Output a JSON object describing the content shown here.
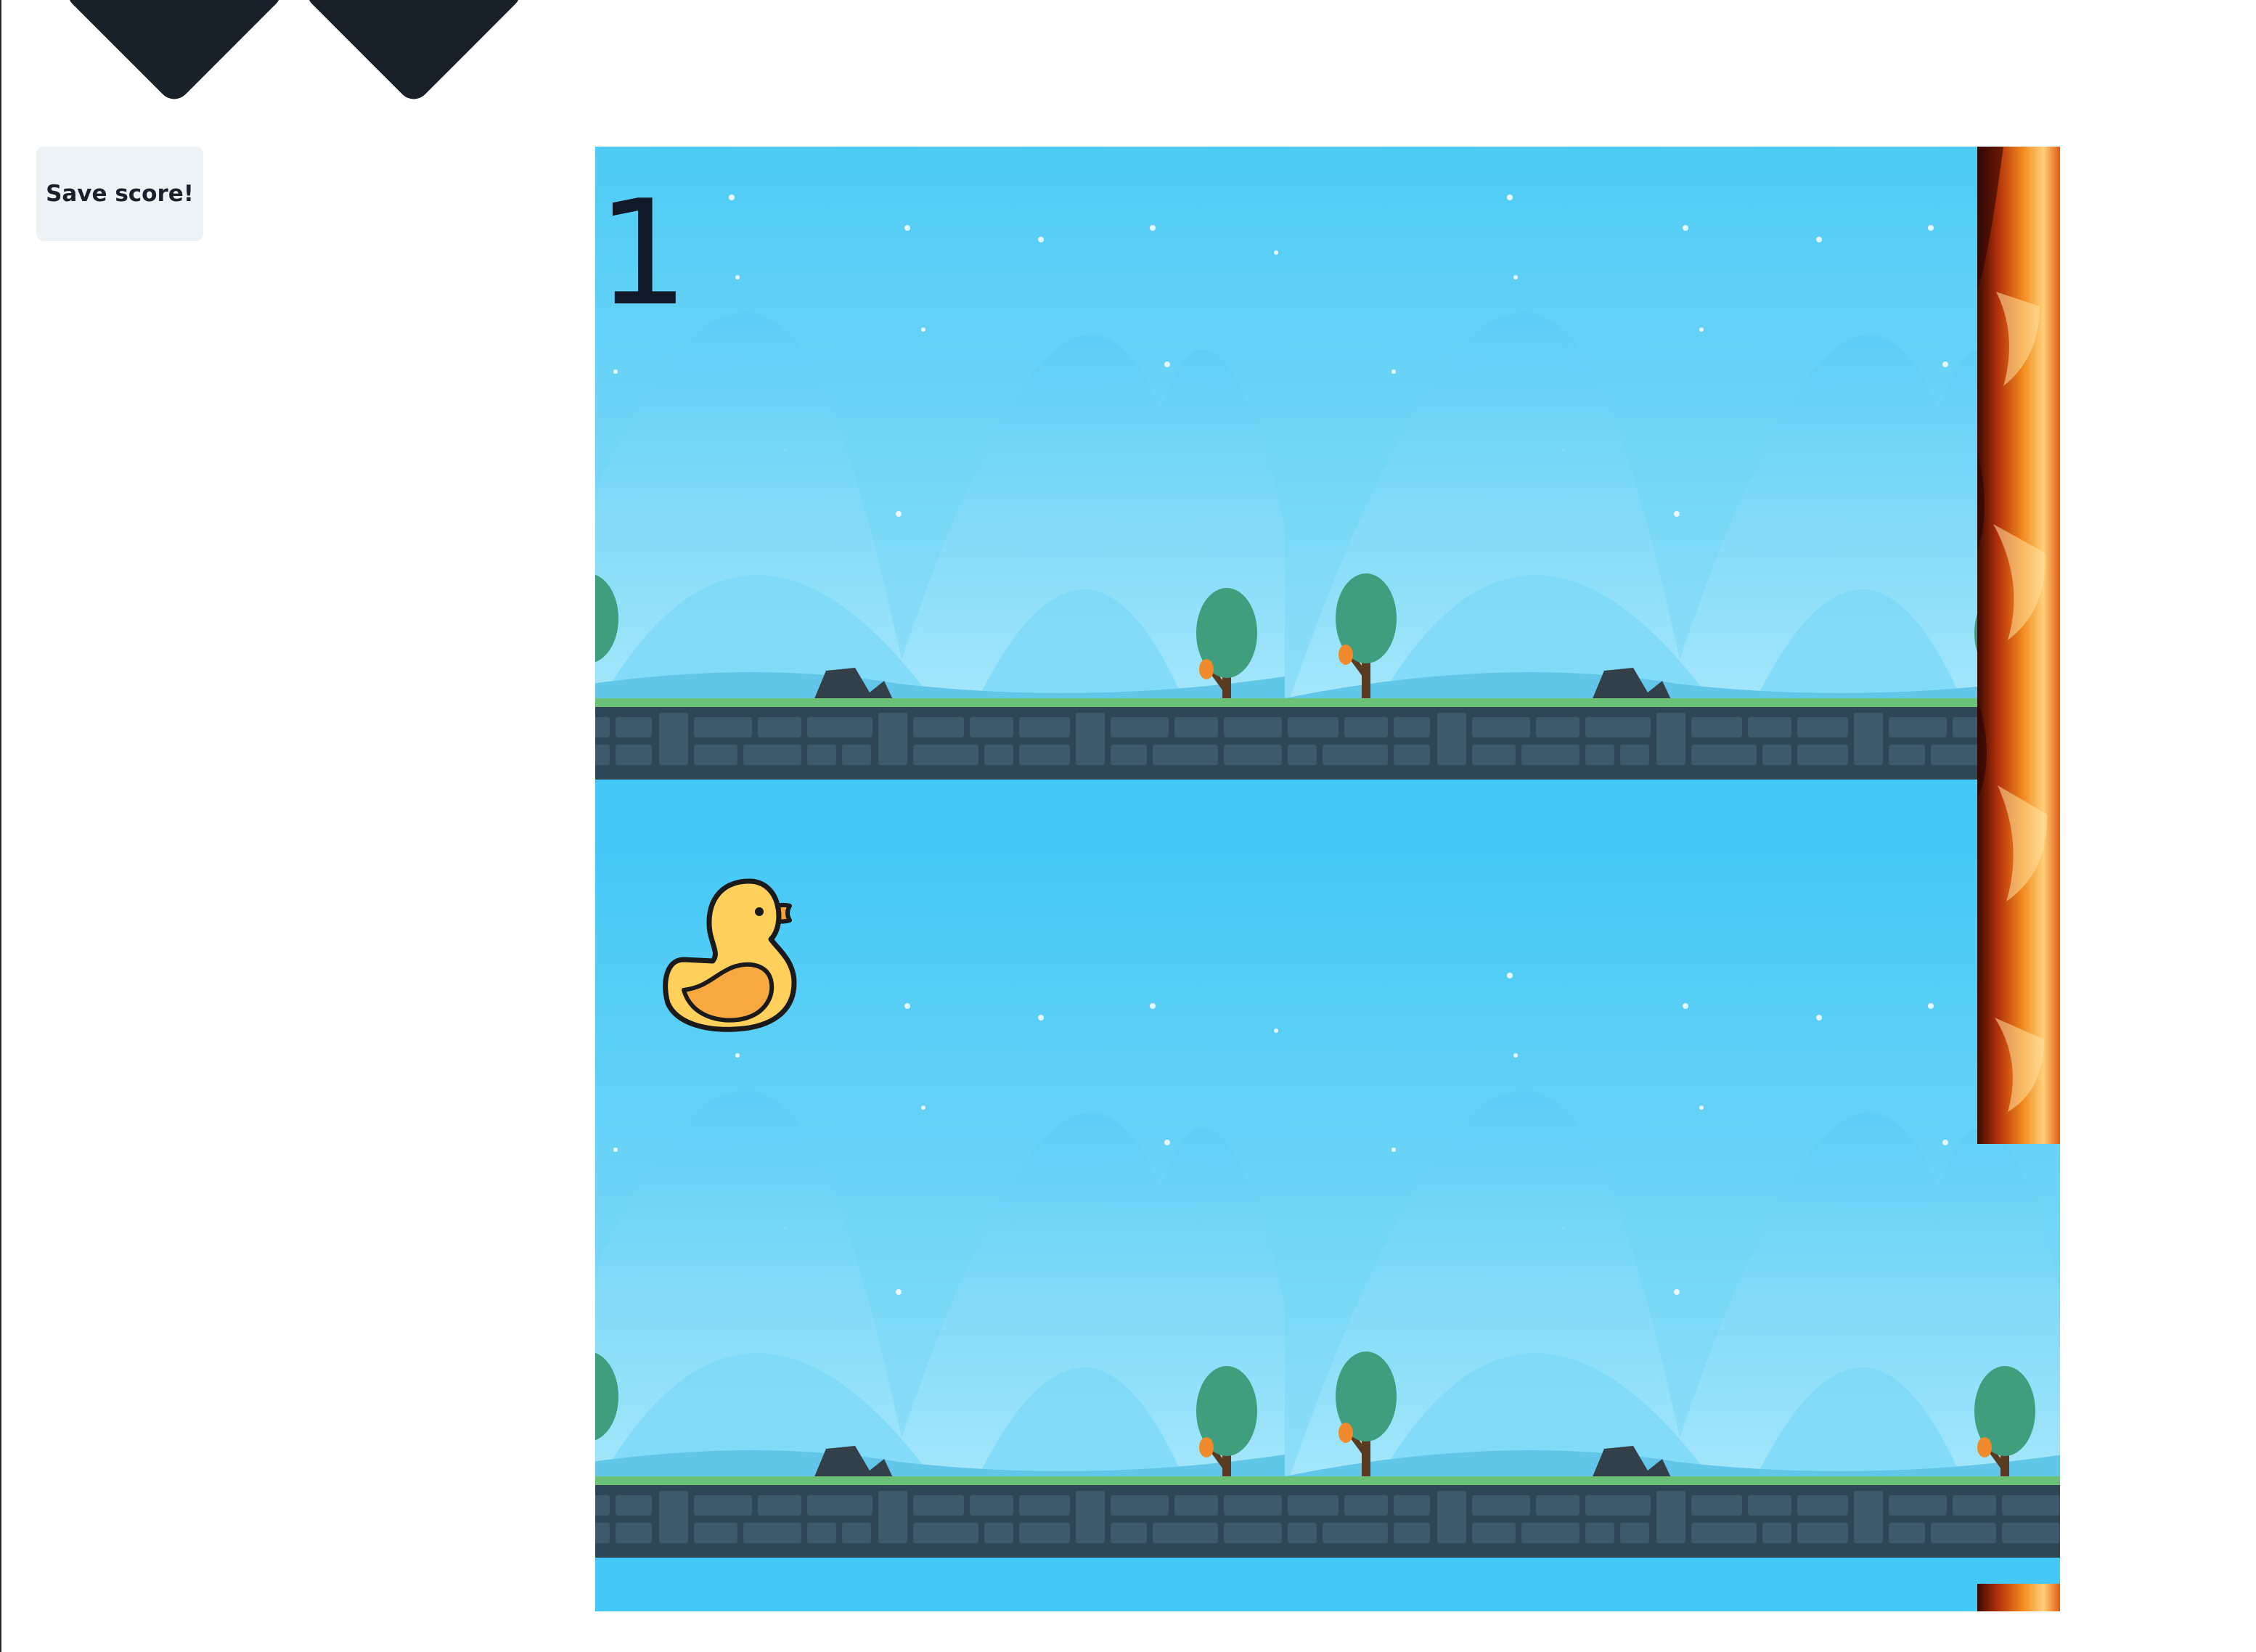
{
  "save_button": {
    "label": "Save score!"
  },
  "game": {
    "score": "1",
    "player_icon": "duck-icon",
    "obstacle_icon": "fire-icon",
    "logo_icon": "chevron-logo-icon",
    "colors": {
      "sky": "#44c8f5",
      "ground_stone": "#2f4858",
      "grass": "#5bb86a",
      "duck_body": "#ffd15c",
      "fire": "#f07a1a"
    }
  }
}
